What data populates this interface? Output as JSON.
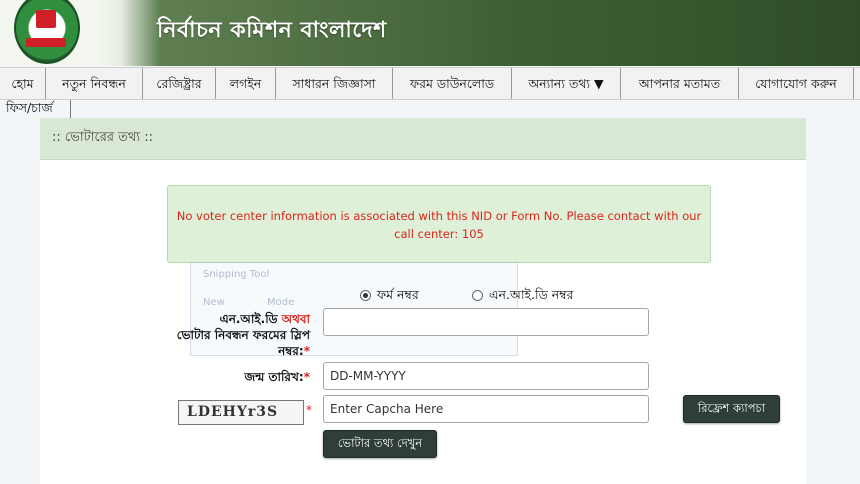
{
  "header": {
    "title": "নির্বাচন কমিশন বাংলাদেশ",
    "logo": "election-commission-logo"
  },
  "nav": {
    "items": [
      {
        "label": "হোম"
      },
      {
        "label": "নতুন নিবন্ধন"
      },
      {
        "label": "রেজিষ্ট্রার"
      },
      {
        "label": "লগইন"
      },
      {
        "label": "সাধারন জিজ্ঞাসা"
      },
      {
        "label": "ফরম ডাউনলোড"
      },
      {
        "label": "অন্যান্য তথ্য ▼"
      },
      {
        "label": "আপনার মতামত"
      },
      {
        "label": "যোগাযোগ করুন"
      }
    ],
    "sub_item": "ফিস/চার্জ"
  },
  "section": {
    "title": ":: ভোটারের তথ্য ::"
  },
  "alert": {
    "message": "No voter center information is associated with this NID or Form No. Please contact with our call center: 105",
    "color": "#d9251c"
  },
  "ghost_overlay": {
    "title": "Snipping Tool",
    "new": "New",
    "mode": "Mode"
  },
  "form": {
    "radio_form_label": "ফর্ম নম্বর",
    "radio_nid_label": "এন.আই.ডি নম্বর",
    "selected": "form",
    "id_label_prefix": "এন.আই.ডি",
    "id_label_or": "অথবা",
    "id_label_rest": "ভোটার নিবন্ধন ফরমের স্লিপ নম্বর:",
    "id_value": "",
    "dob_label": "জন্ম তারিখ:",
    "dob_placeholder": "DD-MM-YYYY",
    "captcha_text": "LDEHYr3S",
    "captcha_placeholder": "Enter Capcha Here",
    "refresh_button": "রিফ্রেশ ক্যাপচা",
    "submit_button": "ভোটার তথ্য দেখুন",
    "required_mark": "*"
  }
}
